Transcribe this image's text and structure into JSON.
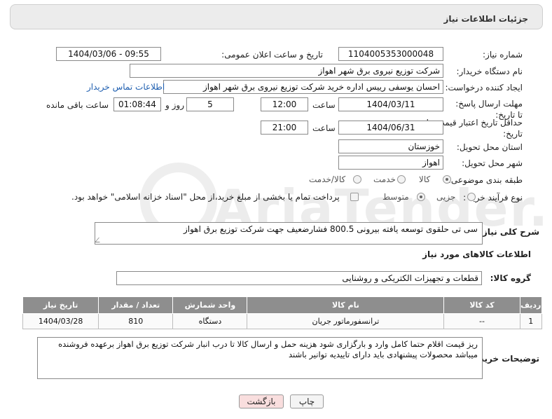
{
  "header": {
    "title": "جزئیات اطلاعات نیاز"
  },
  "fields": {
    "need_number_label": "شماره نیاز:",
    "need_number": "1104005353000048",
    "announce_label": "تاریخ و ساعت اعلان عمومی:",
    "announce_value": "1404/03/06 - 09:55",
    "buyer_label": "نام دستگاه خریدار:",
    "buyer_value": "شرکت توزیع نیروی برق شهر اهواز",
    "creator_label": "ایجاد کننده درخواست:",
    "creator_value": "احسان یوسفی رییس اداره خرید شرکت توزیع نیروی برق شهر اهواز",
    "contact_link": "اطلاعات تماس خریدار",
    "deadline_label": "مهلت ارسال پاسخ: تا تاریخ:",
    "deadline_date": "1404/03/11",
    "time_label": "ساعت",
    "deadline_time": "12:00",
    "days_value": "5",
    "days_label": "روز و",
    "remaining_time": "01:08:44",
    "remaining_label": "ساعت باقی مانده",
    "validity_label": "حداقل تاریخ اعتبار قیمت: تا تاریخ:",
    "validity_date": "1404/06/31",
    "validity_time": "21:00",
    "province_label": "استان محل تحویل:",
    "province_value": "خوزستان",
    "city_label": "شهر محل تحویل:",
    "city_value": "اهواز",
    "category_label": "طبقه بندی موضوعی:",
    "category_options": [
      "کالا",
      "خدمت",
      "کالا/خدمت"
    ],
    "process_label": "نوع فرآیند خرید :",
    "process_options": [
      "جزیی",
      "متوسط"
    ],
    "payment_note": "پرداخت تمام یا بخشی از مبلغ خرید،از محل \"اسناد خزانه اسلامی\" خواهد بود.",
    "description_label": "شرح کلی نیاز:",
    "description_value": "سی تی حلقوی توسعه یافته بیرونی 800.5 فشارضعیف جهت شرکت توزیع برق اهواز",
    "goods_info_title": "اطلاعات کالاهای مورد نیاز",
    "goods_group_label": "گروه کالا:",
    "goods_group_value": "قطعات و تجهیزات الکتریکی و روشنایی"
  },
  "table": {
    "headers": [
      "ردیف",
      "کد کالا",
      "نام کالا",
      "واحد شمارش",
      "تعداد / مقدار",
      "تاریخ نیاز"
    ],
    "rows": [
      [
        "1",
        "--",
        "ترانسفورماتور جریان",
        "دستگاه",
        "810",
        "1404/03/28"
      ]
    ]
  },
  "buyer_notes": {
    "label": "توضیحات خریدار:",
    "text": "ریز قیمت اقلام حتما کامل وارد و بارگزاری شود هزینه حمل و ارسال کالا تا درب انبار شرکت توزیع برق اهواز برعهده فروشنده میباشد محصولات پیشنهادی باید دارای تاییدیه توانیر باشند"
  },
  "buttons": {
    "print": "چاپ",
    "back": "بازگشت"
  },
  "watermark": "AriaTender.net",
  "colors": {
    "link": "#1f5fb0",
    "table_header": "#8e8e8e",
    "back_button": "#f9dede"
  }
}
